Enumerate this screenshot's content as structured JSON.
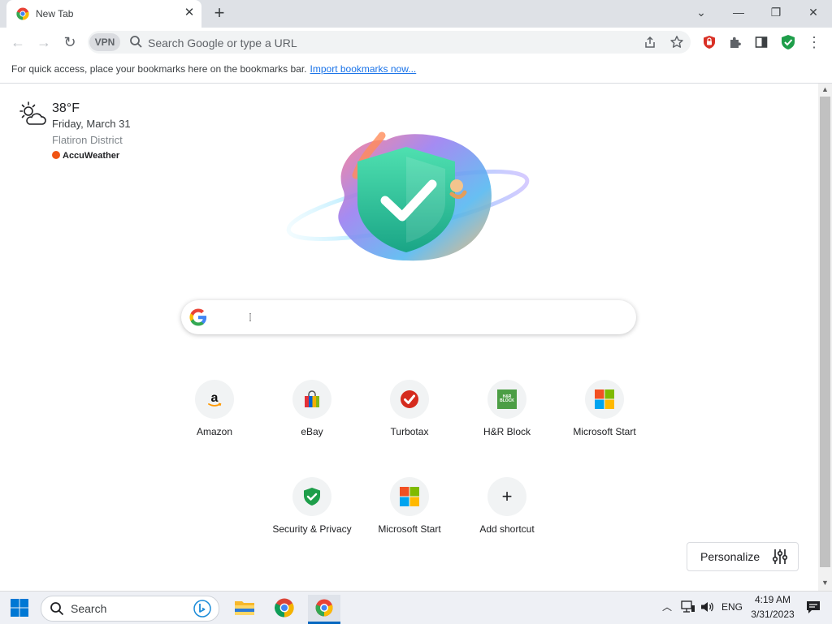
{
  "browser": {
    "tab": {
      "title": "New Tab",
      "close_glyph": "✕"
    },
    "new_tab_glyph": "+",
    "window_controls": {
      "dropdown": "⌄",
      "minimize": "—",
      "restore": "❐",
      "close": "✕"
    },
    "toolbar": {
      "back": "←",
      "forward": "→",
      "reload": "↻",
      "vpn_label": "VPN",
      "omnibox_placeholder": "Search Google or type a URL",
      "more": "⋮"
    },
    "bookmarks_bar": {
      "text": "For quick access, place your bookmarks here on the bookmarks bar.",
      "link": "Import bookmarks now..."
    }
  },
  "weather": {
    "temperature": "38°F",
    "date": "Friday, March 31",
    "location": "Flatiron District",
    "provider": "AccuWeather"
  },
  "shortcuts": [
    {
      "label": "Amazon",
      "icon": "amazon-icon"
    },
    {
      "label": "eBay",
      "icon": "ebay-bag-icon"
    },
    {
      "label": "Turbotax",
      "icon": "turbotax-check-icon"
    },
    {
      "label": "H&R Block",
      "icon": "hr-block-icon",
      "glyph_text": "H&R BLOCK"
    },
    {
      "label": "Microsoft Start",
      "icon": "microsoft-logo-icon"
    },
    {
      "label": "Security & Privacy",
      "icon": "shield-check-icon"
    },
    {
      "label": "Microsoft Start",
      "icon": "microsoft-logo-icon"
    },
    {
      "label": "Add shortcut",
      "icon": "plus-icon",
      "glyph_text": "+"
    }
  ],
  "personalize": {
    "label": "Personalize"
  },
  "taskbar": {
    "search_placeholder": "Search",
    "language": "ENG",
    "time": "4:19 AM",
    "date": "3/31/2023"
  },
  "colors": {
    "accent_blue": "#1a73e8",
    "tabstrip_bg": "#dee1e6",
    "shield_green": "#1e9e4a",
    "turbotax_red": "#d52b1e",
    "hr_block_green": "#4c9e45",
    "accuweather_orange": "#f05514"
  }
}
